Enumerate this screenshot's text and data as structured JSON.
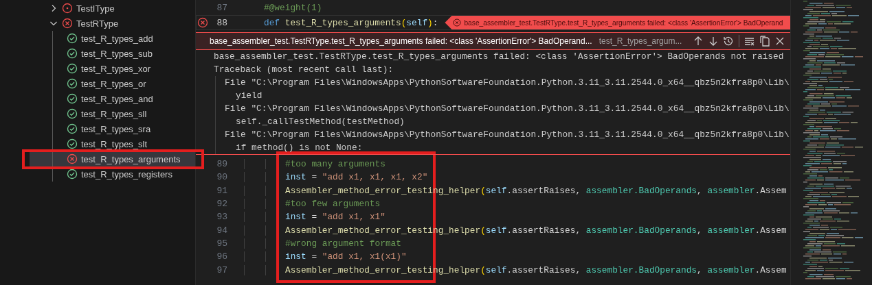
{
  "sidebar": {
    "tree": [
      {
        "label": "TestIType",
        "kind": "unset",
        "expanded": false,
        "selected": false
      },
      {
        "label": "TestRType",
        "kind": "failed",
        "expanded": true,
        "selected": false,
        "children": [
          {
            "label": "test_R_types_add",
            "kind": "passed",
            "selected": false
          },
          {
            "label": "test_R_types_sub",
            "kind": "passed",
            "selected": false
          },
          {
            "label": "test_R_types_xor",
            "kind": "passed",
            "selected": false
          },
          {
            "label": "test_R_types_or",
            "kind": "passed",
            "selected": false
          },
          {
            "label": "test_R_types_and",
            "kind": "passed",
            "selected": false
          },
          {
            "label": "test_R_types_sll",
            "kind": "passed",
            "selected": false
          },
          {
            "label": "test_R_types_sra",
            "kind": "passed",
            "selected": false
          },
          {
            "label": "test_R_types_slt",
            "kind": "passed",
            "selected": false
          },
          {
            "label": "test_R_types_arguments",
            "kind": "failed",
            "selected": true
          },
          {
            "label": "test_R_types_registers",
            "kind": "passed",
            "selected": false
          }
        ]
      }
    ]
  },
  "editor": {
    "top_lines": [
      {
        "number": "87",
        "error": false,
        "tokens": [
          {
            "kind": "comment",
            "text": "#@weight(1)"
          }
        ]
      },
      {
        "number": "88",
        "error": true,
        "inline_error": "base_assembler_test.TestRType.test_R_types_arguments failed: <class 'AssertionError'> BadOperand",
        "tokens": [
          {
            "kind": "keyword",
            "text": "def "
          },
          {
            "kind": "function",
            "text": "test_R_types_arguments"
          },
          {
            "kind": "bracket",
            "text": "("
          },
          {
            "kind": "variable",
            "text": "self"
          },
          {
            "kind": "bracket",
            "text": ")"
          },
          {
            "kind": "plain",
            "text": ":"
          }
        ]
      }
    ],
    "peek": {
      "title": "base_assembler_test.TestRType.test_R_types_arguments failed: <class 'AssertionError'> BadOperand...",
      "subtitle": "test_R_types_argum...",
      "message": "base_assembler_test.TestRType.test_R_types_arguments failed: <class 'AssertionError'> BadOperands not raised",
      "traceback": {
        "heading": "Traceback (most recent call last):",
        "frames": [
          {
            "location": "File \"C:\\Program Files\\WindowsApps\\PythonSoftwareFoundation.Python.3.11_3.11.2544.0_x64__qbz5n2kfra8p0\\Lib\\",
            "code": "yield"
          },
          {
            "location": "File \"C:\\Program Files\\WindowsApps\\PythonSoftwareFoundation.Python.3.11_3.11.2544.0_x64__qbz5n2kfra8p0\\Lib\\",
            "code": "self._callTestMethod(testMethod)"
          },
          {
            "location": "File \"C:\\Program Files\\WindowsApps\\PythonSoftwareFoundation.Python.3.11_3.11.2544.0_x64__qbz5n2kfra8p0\\Lib\\",
            "code": "if method() is not None:"
          }
        ]
      }
    },
    "lines": [
      {
        "number": "89",
        "tokens": [
          {
            "kind": "comment",
            "text": "#too many arguments"
          }
        ]
      },
      {
        "number": "90",
        "tokens": [
          {
            "kind": "variable",
            "text": "inst"
          },
          {
            "kind": "plain",
            "text": " = "
          },
          {
            "kind": "string",
            "text": "\"add x1, x1, x1, x2\""
          }
        ]
      },
      {
        "number": "91",
        "tokens": [
          {
            "kind": "function",
            "text": "Assembler_method_error_testing_helper"
          },
          {
            "kind": "bracket",
            "text": "("
          },
          {
            "kind": "variable",
            "text": "self"
          },
          {
            "kind": "plain",
            "text": ".assertRaises, "
          },
          {
            "kind": "class",
            "text": "assembler.BadOperands"
          },
          {
            "kind": "plain",
            "text": ", "
          },
          {
            "kind": "class",
            "text": "assembler"
          },
          {
            "kind": "plain",
            "text": ".Assem"
          }
        ]
      },
      {
        "number": "92",
        "tokens": [
          {
            "kind": "comment",
            "text": "#too few arguments"
          }
        ]
      },
      {
        "number": "93",
        "tokens": [
          {
            "kind": "variable",
            "text": "inst"
          },
          {
            "kind": "plain",
            "text": " = "
          },
          {
            "kind": "string",
            "text": "\"add x1, x1\""
          }
        ]
      },
      {
        "number": "94",
        "tokens": [
          {
            "kind": "function",
            "text": "Assembler_method_error_testing_helper"
          },
          {
            "kind": "bracket",
            "text": "("
          },
          {
            "kind": "variable",
            "text": "self"
          },
          {
            "kind": "plain",
            "text": ".assertRaises, "
          },
          {
            "kind": "class",
            "text": "assembler.BadOperands"
          },
          {
            "kind": "plain",
            "text": ", "
          },
          {
            "kind": "class",
            "text": "assembler"
          },
          {
            "kind": "plain",
            "text": ".Assem"
          }
        ]
      },
      {
        "number": "95",
        "tokens": [
          {
            "kind": "comment",
            "text": "#wrong argument format"
          }
        ]
      },
      {
        "number": "96",
        "tokens": [
          {
            "kind": "variable",
            "text": "inst"
          },
          {
            "kind": "plain",
            "text": " = "
          },
          {
            "kind": "string",
            "text": "\"add x1, x1(x1)\""
          }
        ]
      },
      {
        "number": "97",
        "tokens": [
          {
            "kind": "function",
            "text": "Assembler_method_error_testing_helper"
          },
          {
            "kind": "bracket",
            "text": "("
          },
          {
            "kind": "variable",
            "text": "self"
          },
          {
            "kind": "plain",
            "text": ".assertRaises, "
          },
          {
            "kind": "class",
            "text": "assembler.BadOperands"
          },
          {
            "kind": "plain",
            "text": ", "
          },
          {
            "kind": "class",
            "text": "assembler"
          },
          {
            "kind": "plain",
            "text": ".Assem"
          }
        ]
      }
    ]
  }
}
